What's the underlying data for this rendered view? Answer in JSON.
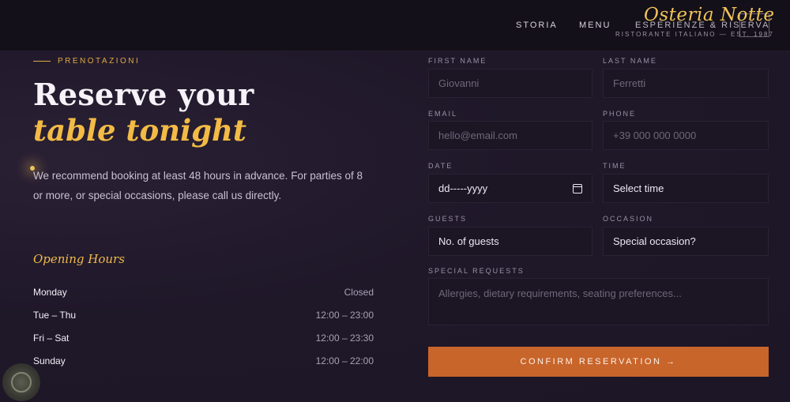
{
  "header": {
    "nav": [
      "STORIA",
      "MENU",
      "ESPERIENZE & RISERVA"
    ],
    "logo": "Osteria Notte",
    "logo_sub": "RISTORANTE ITALIANO — EST. 1987"
  },
  "hero": {
    "eyebrow": "PRENOTAZIONI",
    "headline_1": "Reserve your",
    "headline_2": "table tonight",
    "intro": "We recommend booking at least 48 hours in advance. For parties of 8 or more, or special occasions, please call us directly."
  },
  "hours": {
    "title": "Opening Hours",
    "rows": [
      {
        "day": "Monday",
        "time": "Closed"
      },
      {
        "day": "Tue – Thu",
        "time": "12:00 – 23:00"
      },
      {
        "day": "Fri – Sat",
        "time": "12:00 – 23:30"
      },
      {
        "day": "Sunday",
        "time": "12:00 – 22:00"
      }
    ]
  },
  "form": {
    "first_name": {
      "label": "FIRST NAME",
      "placeholder": "Giovanni"
    },
    "last_name": {
      "label": "LAST NAME",
      "placeholder": "Ferretti"
    },
    "email": {
      "label": "EMAIL",
      "placeholder": "hello@email.com"
    },
    "phone": {
      "label": "PHONE",
      "placeholder": "+39 000 000 0000"
    },
    "date": {
      "label": "DATE",
      "value": "dd-----yyyy"
    },
    "time": {
      "label": "TIME",
      "value": "Select time"
    },
    "guests": {
      "label": "GUESTS",
      "value": "No. of guests"
    },
    "occasion": {
      "label": "OCCASION",
      "value": "Special occasion?"
    },
    "requests": {
      "label": "SPECIAL REQUESTS",
      "placeholder": "Allergies, dietary requirements, seating preferences..."
    },
    "submit": "CONFIRM RESERVATION →"
  },
  "colors": {
    "accent": "#f3bb45",
    "cta": "#c8652b",
    "background": "#1f1829"
  }
}
